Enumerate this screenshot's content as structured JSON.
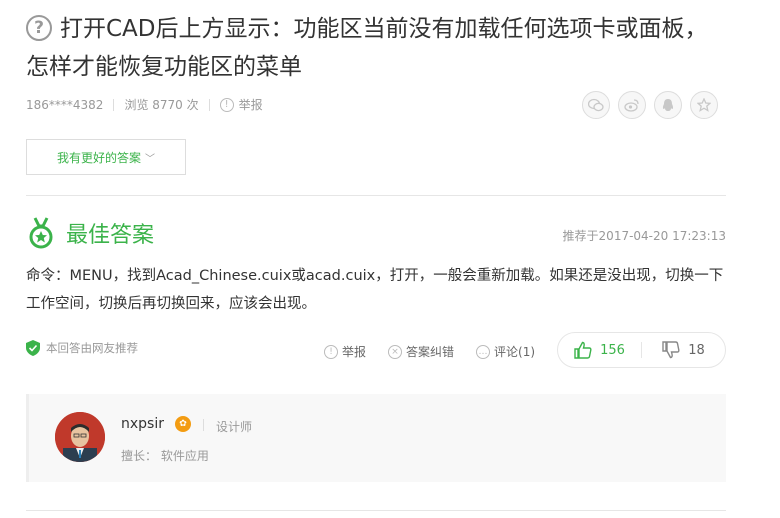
{
  "question": {
    "icon": "question-circle-icon",
    "title": "打开CAD后上方显示：功能区当前没有加载任何选项卡或面板，怎样才能恢复功能区的菜单"
  },
  "meta": {
    "user": "186****4382",
    "views": "浏览 8770 次",
    "report": "举报"
  },
  "share_icons": [
    "wechat-icon",
    "weibo-icon",
    "qq-icon",
    "favorite-star-icon"
  ],
  "better_answer_button": "我有更好的答案",
  "best_answer": {
    "title": "最佳答案",
    "time": "推荐于2017-04-20 17:23:13",
    "content": "命令：MENU，找到Acad_Chinese.cuix或acad.cuix，打开，一般会重新加载。如果还是没出现，切换一下工作空间，切换后再切换回来，应该会出现。",
    "source": "本回答由网友推荐"
  },
  "actions": {
    "report": "举报",
    "correct": "答案纠错",
    "comment": "评论(1)"
  },
  "votes": {
    "up": "156",
    "down": "18"
  },
  "answerer": {
    "name": "nxpsir",
    "title": "设计师",
    "specialty": "擅长：  软件应用"
  },
  "colors": {
    "accent": "#3bb34a",
    "muted": "#999999",
    "level": "#f39c12"
  }
}
